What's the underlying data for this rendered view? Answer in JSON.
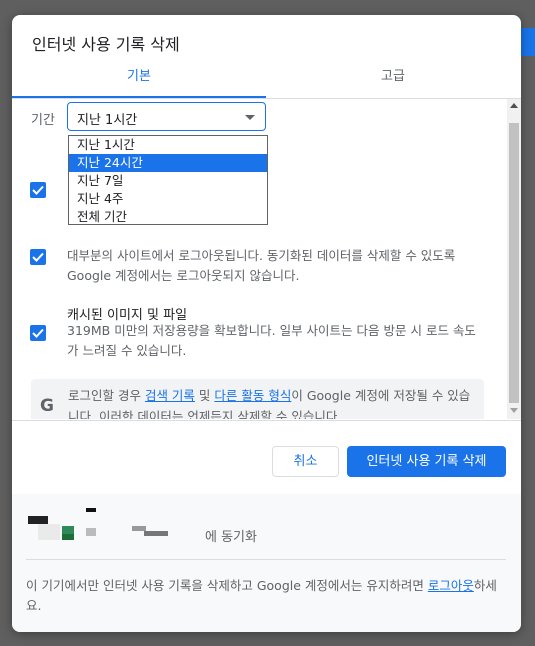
{
  "dialog": {
    "title": "인터넷 사용 기록 삭제",
    "tabs": [
      {
        "label": "기본",
        "active": true
      },
      {
        "label": "고급",
        "active": false
      }
    ]
  },
  "time_range": {
    "label": "기간",
    "selected": "지난 1시간",
    "options": [
      "지난 1시간",
      "지난 24시간",
      "지난 7일",
      "지난 4주",
      "전체 기간"
    ],
    "highlighted_option": "지난 24시간"
  },
  "options": [
    {
      "title": "",
      "description": "",
      "checked": true
    },
    {
      "title": "",
      "description": "대부분의 사이트에서 로그아웃됩니다. 동기화된 데이터를 삭제할 수 있도록 Google 계정에서는 로그아웃되지 않습니다.",
      "checked": true
    },
    {
      "title": "캐시된 이미지 및 파일",
      "description": "319MB 미만의 저장용량을 확보합니다. 일부 사이트는 다음 방문 시 로드 속도가 느려질 수 있습니다.",
      "checked": true
    }
  ],
  "note": {
    "icon": "google-g-icon",
    "text_before": "로그인할 경우 ",
    "link1": "검색 기록",
    "text_mid": " 및 ",
    "link2": "다른 활동 형식",
    "text_after": "이 Google 계정에 저장될 수 있습니다. 이러한 데이터는 언제든지 삭제할 수 있습니다."
  },
  "buttons": {
    "cancel": "취소",
    "confirm": "인터넷 사용 기록 삭제"
  },
  "sync": {
    "label": "에 동기화"
  },
  "footer": {
    "text": "이 기기에서만 인터넷 사용 기록을 삭제하고 Google 계정에서는 유지하려면 ",
    "link": "로그아웃",
    "suffix": "하세요."
  },
  "colors": {
    "accent": "#1a73e8",
    "text_secondary": "#5f6368"
  }
}
